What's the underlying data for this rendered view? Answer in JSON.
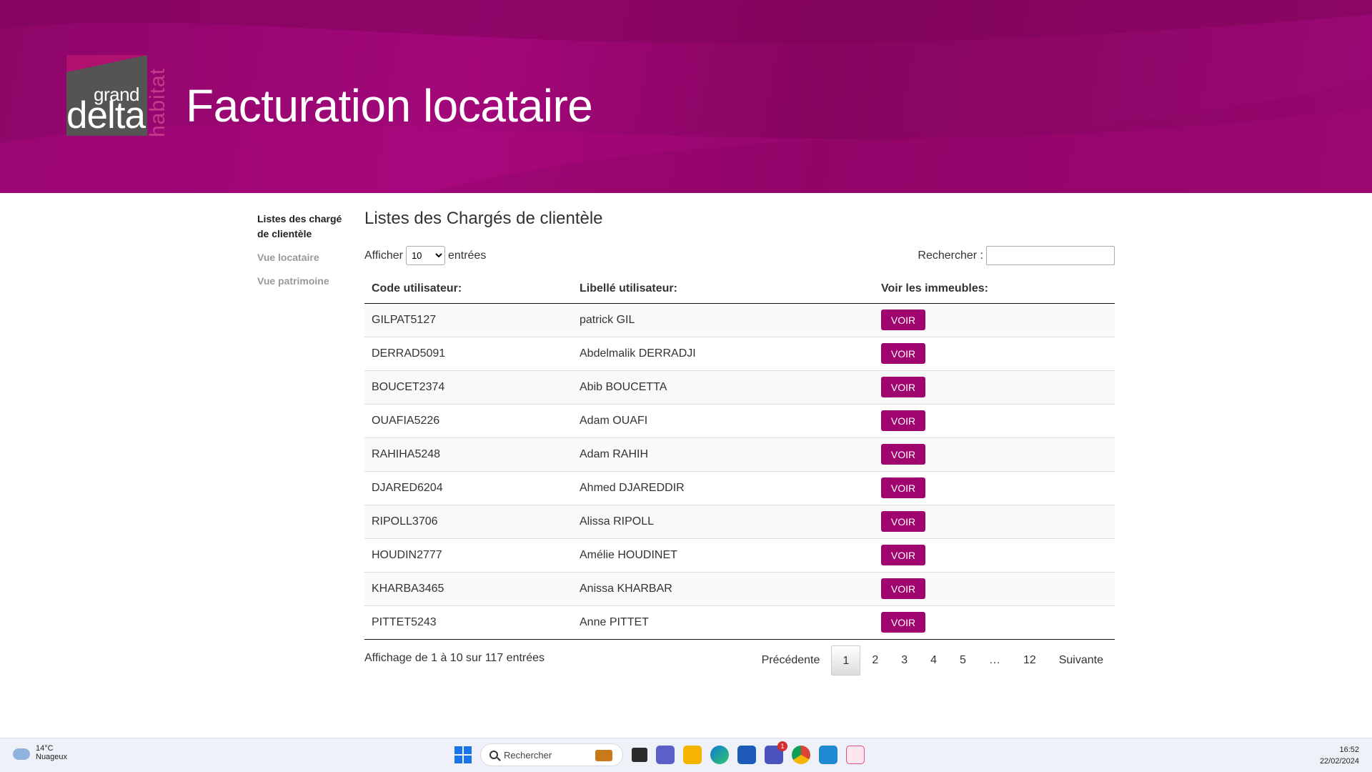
{
  "header": {
    "logo": {
      "word1": "grand",
      "word2": "delta",
      "word3": "habitat"
    },
    "title": "Facturation locataire",
    "colors": {
      "primary": "#a0046e",
      "dark": "#86055f"
    }
  },
  "sidebar": {
    "items": [
      {
        "label": "Listes des chargé de clientèle",
        "active": true
      },
      {
        "label": "Vue locataire",
        "active": false
      },
      {
        "label": "Vue patrimoine",
        "active": false
      }
    ]
  },
  "main": {
    "title": "Listes des Chargés de clientèle",
    "length": {
      "prefix": "Afficher",
      "value": "10",
      "suffix": "entrées"
    },
    "search": {
      "label": "Rechercher :",
      "value": ""
    },
    "columns": [
      "Code utilisateur:",
      "Libellé utilisateur:",
      "Voir les immeubles:"
    ],
    "button_label": "VOIR",
    "rows": [
      {
        "code": "GILPAT5127",
        "name": "patrick GIL"
      },
      {
        "code": "DERRAD5091",
        "name": "Abdelmalik DERRADJI"
      },
      {
        "code": "BOUCET2374",
        "name": "Abib BOUCETTA"
      },
      {
        "code": "OUAFIA5226",
        "name": "Adam OUAFI"
      },
      {
        "code": "RAHIHA5248",
        "name": "Adam RAHIH"
      },
      {
        "code": "DJARED6204",
        "name": "Ahmed DJAREDDIR"
      },
      {
        "code": "RIPOLL3706",
        "name": "Alissa RIPOLL"
      },
      {
        "code": "HOUDIN2777",
        "name": "Amélie HOUDINET"
      },
      {
        "code": "KHARBA3465",
        "name": "Anissa KHARBAR"
      },
      {
        "code": "PITTET5243",
        "name": "Anne PITTET"
      }
    ],
    "info": "Affichage de 1 à 10 sur 117 entrées",
    "pagination": {
      "previous": "Précédente",
      "pages": [
        "1",
        "2",
        "3",
        "4",
        "5",
        "…",
        "12"
      ],
      "current": "1",
      "next": "Suivante"
    }
  },
  "taskbar": {
    "weather": {
      "temp": "14°C",
      "condition": "Nuageux"
    },
    "search_placeholder": "Rechercher",
    "apps": [
      "task-view",
      "teams",
      "file-explorer",
      "edge",
      "store",
      "teams-new",
      "chrome",
      "vscode",
      "snipping-tool"
    ],
    "notification_count": "1",
    "time": "16:52",
    "date": "22/02/2024"
  }
}
